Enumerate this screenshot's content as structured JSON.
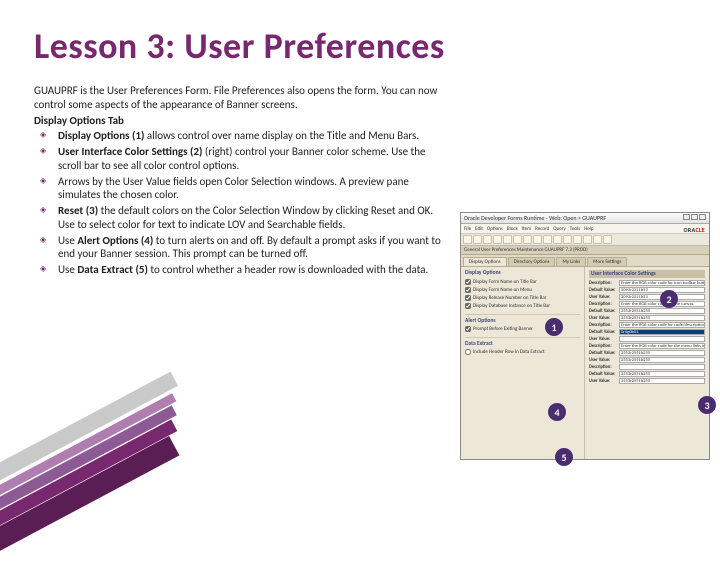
{
  "title": "Lesson 3: User Preferences",
  "intro": "GUAUPRF is the User Preferences Form. File Preferences also opens the form. You can now control some aspects of the appearance of Banner screens.",
  "subhead": "Display Options Tab",
  "bullets": [
    {
      "lead": "Display Options (1)",
      "rest": " allows control over name display on the Title and Menu Bars."
    },
    {
      "lead": "User Interface Color Settings (2)",
      "rest": " (right) control your Banner color scheme. Use the scroll bar to see all color control options."
    },
    {
      "lead": "",
      "rest": "Arrows by the User Value fields open Color Selection windows. A preview pane simulates the chosen color."
    },
    {
      "lead": "Reset (3)",
      "rest": " the default colors on the Color Selection Window by clicking Reset and OK. Use to select color for text to indicate LOV and Searchable fields."
    },
    {
      "lead": "",
      "rest": "Use "
    },
    {
      "lead": "",
      "rest": "Use "
    }
  ],
  "b4": {
    "lead": "Alert Options (4)",
    "rest": " to turn alerts on and off. By default a prompt asks if you want to end your Banner session. This prompt can be turned off."
  },
  "b5": {
    "lead": "Data Extract (5)",
    "rest": " to control whether a header row is downloaded with the data."
  },
  "app": {
    "wtitle": "Oracle Developer Forms Runtime - Web: Open > GUAUPRF",
    "menu": [
      "File",
      "Edit",
      "Options",
      "Block",
      "Item",
      "Record",
      "Query",
      "Tools",
      "Help"
    ],
    "brandPre": "ORA",
    "brandRed": "CLE",
    "formbar": "General User Preferences Maintenance GUAUPRF 7.3 (PROD)",
    "tabs": [
      "Display Options",
      "Directory Options",
      "My Links",
      "More Settings"
    ],
    "leftTitle": "Display Options",
    "chks": [
      "Display Form Name on Title Bar",
      "Display Form Name on Menu",
      "Display Release Number on Title Bar",
      "Display Database Instance on Title Bar"
    ],
    "alertTitle": "Alert Options",
    "alertChk": "Prompt Before Exiting Banner",
    "extractTitle": "Data Extract",
    "extractChk": "Include Header Row in Data Extract",
    "rightTitle": "User Interface Color Settings",
    "rows": [
      {
        "lbl": "Description:",
        "val": "Enter the RGB color code for icon toolbar buttons."
      },
      {
        "lbl": "Default Value:",
        "val": "2093r2311b53"
      },
      {
        "lbl": "User Value:",
        "val": "2093r2311b53"
      },
      {
        "lbl": "Description:",
        "val": "Enter the RGB color code for the canvas."
      },
      {
        "lbl": "Default Value:",
        "val": "2553r2551b255"
      },
      {
        "lbl": "User Value:",
        "val": "2553r2551b255"
      },
      {
        "lbl": "Description:",
        "val": "Enter the RGB color code for code/description prompts."
      },
      {
        "lbl": "Default Value:",
        "val": "0r0g0b51",
        "hl": true
      },
      {
        "lbl": "User Value:",
        "val": ""
      },
      {
        "lbl": "Description:",
        "val": "Enter the RGB color code for the menu links in the menu bar."
      },
      {
        "lbl": "Default Value:",
        "val": "2553r2551b255"
      },
      {
        "lbl": "User Value:",
        "val": "2553r2551b255"
      },
      {
        "lbl": "Description:",
        "val": ""
      },
      {
        "lbl": "Default Value:",
        "val": "2553r2551b255"
      },
      {
        "lbl": "User Value:",
        "val": "2553r2551b255"
      }
    ]
  },
  "callouts": [
    "1",
    "2",
    "3",
    "4",
    "5"
  ]
}
